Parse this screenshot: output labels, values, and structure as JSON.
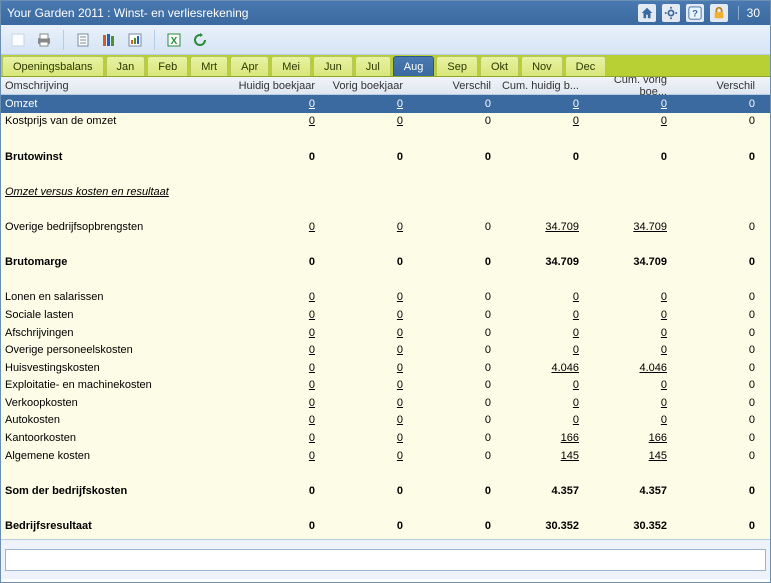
{
  "titlebar": {
    "title": "Your Garden 2011 : Winst- en verliesrekening",
    "count": "30"
  },
  "tabs": {
    "items": [
      "Openingsbalans",
      "Jan",
      "Feb",
      "Mrt",
      "Apr",
      "Mei",
      "Jun",
      "Jul",
      "Aug",
      "Sep",
      "Okt",
      "Nov",
      "Dec"
    ],
    "selectedIndex": 8
  },
  "columns": [
    "Omschrijving",
    "Huidig boekjaar",
    "Vorig boekjaar",
    "Verschil",
    "Cum. huidig b...",
    "Cum. vorig boe...",
    "Verschil"
  ],
  "rows": [
    {
      "type": "data",
      "desc": "Omzet",
      "vals": [
        "0",
        "0",
        "0",
        "0",
        "0",
        "0"
      ],
      "und": [
        true,
        true,
        false,
        true,
        true,
        false
      ],
      "sel": true
    },
    {
      "type": "data",
      "desc": "Kostprijs van de omzet",
      "vals": [
        "0",
        "0",
        "0",
        "0",
        "0",
        "0"
      ],
      "und": [
        true,
        true,
        false,
        true,
        true,
        false
      ]
    },
    {
      "type": "spacer"
    },
    {
      "type": "data",
      "desc": "Brutowinst",
      "vals": [
        "0",
        "0",
        "0",
        "0",
        "0",
        "0"
      ],
      "bold": true
    },
    {
      "type": "spacer"
    },
    {
      "type": "section",
      "desc": "Omzet versus kosten en resultaat"
    },
    {
      "type": "spacer"
    },
    {
      "type": "data",
      "desc": "Overige bedrijfsopbrengsten",
      "vals": [
        "0",
        "0",
        "0",
        "34.709",
        "34.709",
        "0"
      ],
      "und": [
        true,
        true,
        false,
        true,
        true,
        false
      ]
    },
    {
      "type": "spacer"
    },
    {
      "type": "data",
      "desc": "Brutomarge",
      "vals": [
        "0",
        "0",
        "0",
        "34.709",
        "34.709",
        "0"
      ],
      "bold": true
    },
    {
      "type": "spacer"
    },
    {
      "type": "data",
      "desc": "Lonen en salarissen",
      "vals": [
        "0",
        "0",
        "0",
        "0",
        "0",
        "0"
      ],
      "und": [
        true,
        true,
        false,
        true,
        true,
        false
      ]
    },
    {
      "type": "data",
      "desc": "Sociale lasten",
      "vals": [
        "0",
        "0",
        "0",
        "0",
        "0",
        "0"
      ],
      "und": [
        true,
        true,
        false,
        true,
        true,
        false
      ]
    },
    {
      "type": "data",
      "desc": "Afschrijvingen",
      "vals": [
        "0",
        "0",
        "0",
        "0",
        "0",
        "0"
      ],
      "und": [
        true,
        true,
        false,
        true,
        true,
        false
      ]
    },
    {
      "type": "data",
      "desc": "Overige personeelskosten",
      "vals": [
        "0",
        "0",
        "0",
        "0",
        "0",
        "0"
      ],
      "und": [
        true,
        true,
        false,
        true,
        true,
        false
      ]
    },
    {
      "type": "data",
      "desc": "Huisvestingskosten",
      "vals": [
        "0",
        "0",
        "0",
        "4.046",
        "4.046",
        "0"
      ],
      "und": [
        true,
        true,
        false,
        true,
        true,
        false
      ]
    },
    {
      "type": "data",
      "desc": "Exploitatie- en machinekosten",
      "vals": [
        "0",
        "0",
        "0",
        "0",
        "0",
        "0"
      ],
      "und": [
        true,
        true,
        false,
        true,
        true,
        false
      ]
    },
    {
      "type": "data",
      "desc": "Verkoopkosten",
      "vals": [
        "0",
        "0",
        "0",
        "0",
        "0",
        "0"
      ],
      "und": [
        true,
        true,
        false,
        true,
        true,
        false
      ]
    },
    {
      "type": "data",
      "desc": "Autokosten",
      "vals": [
        "0",
        "0",
        "0",
        "0",
        "0",
        "0"
      ],
      "und": [
        true,
        true,
        false,
        true,
        true,
        false
      ]
    },
    {
      "type": "data",
      "desc": "Kantoorkosten",
      "vals": [
        "0",
        "0",
        "0",
        "166",
        "166",
        "0"
      ],
      "und": [
        true,
        true,
        false,
        true,
        true,
        false
      ]
    },
    {
      "type": "data",
      "desc": "Algemene kosten",
      "vals": [
        "0",
        "0",
        "0",
        "145",
        "145",
        "0"
      ],
      "und": [
        true,
        true,
        false,
        true,
        true,
        false
      ]
    },
    {
      "type": "spacer"
    },
    {
      "type": "data",
      "desc": "Som der bedrijfskosten",
      "vals": [
        "0",
        "0",
        "0",
        "4.357",
        "4.357",
        "0"
      ],
      "bold": true
    },
    {
      "type": "spacer"
    },
    {
      "type": "data",
      "desc": "Bedrijfsresultaat",
      "vals": [
        "0",
        "0",
        "0",
        "30.352",
        "30.352",
        "0"
      ],
      "bold": true
    }
  ],
  "strip": {
    "value": ""
  }
}
